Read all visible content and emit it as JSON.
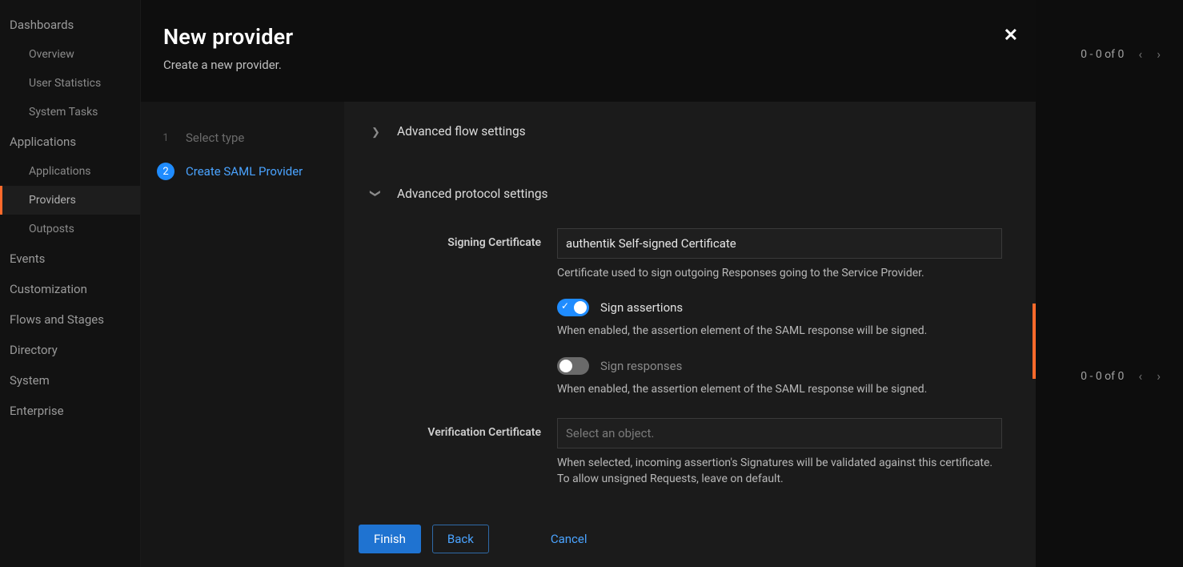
{
  "sidebar": {
    "sections": [
      {
        "label": "Dashboards",
        "items": [
          "Overview",
          "User Statistics",
          "System Tasks"
        ]
      },
      {
        "label": "Applications",
        "items": [
          "Applications",
          "Providers",
          "Outposts"
        ],
        "activeIndex": 1
      },
      {
        "label": "Events"
      },
      {
        "label": "Customization"
      },
      {
        "label": "Flows and Stages"
      },
      {
        "label": "Directory"
      },
      {
        "label": "System"
      },
      {
        "label": "Enterprise"
      }
    ]
  },
  "bg": {
    "pagination_top": "0 - 0 of 0",
    "pagination_bottom": "0 - 0 of 0"
  },
  "modal": {
    "title": "New provider",
    "subtitle": "Create a new provider.",
    "steps": [
      {
        "num": "1",
        "label": "Select type"
      },
      {
        "num": "2",
        "label": "Create SAML Provider"
      }
    ],
    "section_flow": "Advanced flow settings",
    "section_proto": "Advanced protocol settings",
    "signing_cert_label": "Signing Certificate",
    "signing_cert_value": "authentik Self-signed Certificate",
    "signing_cert_help": "Certificate used to sign outgoing Responses going to the Service Provider.",
    "sign_assertions_label": "Sign assertions",
    "sign_assertions_help": "When enabled, the assertion element of the SAML response will be signed.",
    "sign_responses_label": "Sign responses",
    "sign_responses_help": "When enabled, the assertion element of the SAML response will be signed.",
    "verification_cert_label": "Verification Certificate",
    "verification_cert_placeholder": "Select an object.",
    "verification_cert_help": "When selected, incoming assertion's Signatures will be validated against this certificate. To allow unsigned Requests, leave on default.",
    "footer": {
      "finish": "Finish",
      "back": "Back",
      "cancel": "Cancel"
    }
  }
}
